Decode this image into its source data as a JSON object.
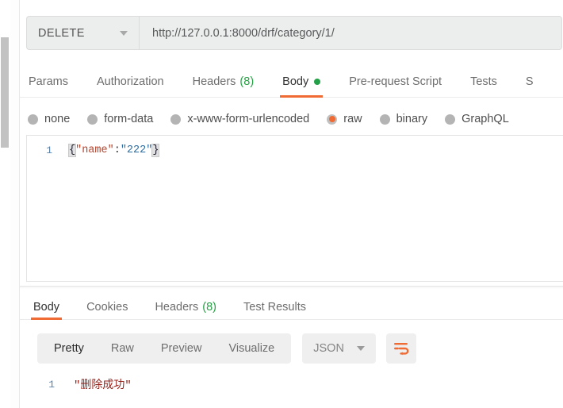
{
  "request": {
    "method": "DELETE",
    "url": "http://127.0.0.1:8000/drf/category/1/",
    "tabs": [
      {
        "label": "Params",
        "count": "",
        "active": false,
        "dot": false
      },
      {
        "label": "Authorization",
        "count": "",
        "active": false,
        "dot": false
      },
      {
        "label": "Headers",
        "count": "(8)",
        "active": false,
        "dot": false
      },
      {
        "label": "Body",
        "count": "",
        "active": true,
        "dot": true
      },
      {
        "label": "Pre-request Script",
        "count": "",
        "active": false,
        "dot": false
      },
      {
        "label": "Tests",
        "count": "",
        "active": false,
        "dot": false
      },
      {
        "label": "S",
        "count": "",
        "active": false,
        "dot": false
      }
    ],
    "body_types": [
      {
        "label": "none",
        "selected": false
      },
      {
        "label": "form-data",
        "selected": false
      },
      {
        "label": "x-www-form-urlencoded",
        "selected": false
      },
      {
        "label": "raw",
        "selected": true
      },
      {
        "label": "binary",
        "selected": false
      },
      {
        "label": "GraphQL",
        "selected": false
      }
    ],
    "editor": {
      "line_number": "1",
      "brace_open": "{",
      "key": "\"name\"",
      "colon": ":",
      "value": "\"222\"",
      "brace_close": "}"
    }
  },
  "response": {
    "tabs": [
      {
        "label": "Body",
        "count": "",
        "active": true
      },
      {
        "label": "Cookies",
        "count": "",
        "active": false
      },
      {
        "label": "Headers",
        "count": "(8)",
        "active": false
      },
      {
        "label": "Test Results",
        "count": "",
        "active": false
      }
    ],
    "view_modes": [
      {
        "label": "Pretty",
        "active": true
      },
      {
        "label": "Raw",
        "active": false
      },
      {
        "label": "Preview",
        "active": false
      },
      {
        "label": "Visualize",
        "active": false
      }
    ],
    "format": "JSON",
    "wrap_icon": "wrap-text-icon",
    "body": {
      "line_number": "1",
      "text": "\"删除成功\""
    }
  },
  "colors": {
    "accent": "#ef6b33",
    "success": "#24a148",
    "control_bg": "#efefef",
    "field_bg": "#eceded"
  }
}
